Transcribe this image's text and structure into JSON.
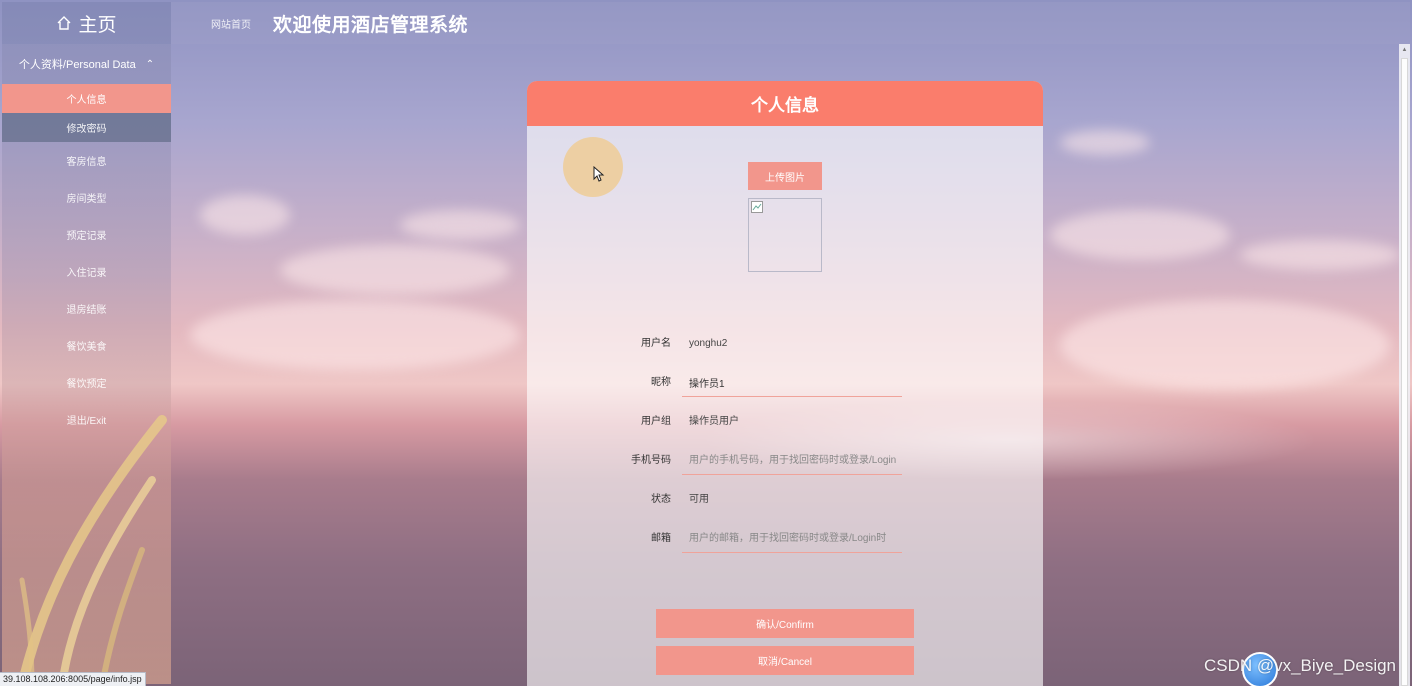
{
  "sidebar": {
    "home_label": "主页",
    "section_label": "个人资料/Personal Data",
    "items": [
      {
        "label": "个人信息"
      },
      {
        "label": "修改密码"
      },
      {
        "label": "客房信息"
      },
      {
        "label": "房间类型"
      },
      {
        "label": "预定记录"
      },
      {
        "label": "入住记录"
      },
      {
        "label": "退房结账"
      },
      {
        "label": "餐饮美食"
      },
      {
        "label": "餐饮预定"
      },
      {
        "label": "退出/Exit"
      }
    ]
  },
  "header": {
    "breadcrumb": "网站首页",
    "title": "欢迎使用酒店管理系统"
  },
  "panel": {
    "title": "个人信息",
    "upload_label": "上传图片",
    "fields": {
      "username": {
        "label": "用户名",
        "value": "yonghu2"
      },
      "nickname": {
        "label": "昵称",
        "value": "操作员1"
      },
      "group": {
        "label": "用户组",
        "value": "操作员用户"
      },
      "phone": {
        "label": "手机号码",
        "placeholder": "用户的手机号码，用于找回密码时或登录/Login"
      },
      "status": {
        "label": "状态",
        "value": "可用"
      },
      "email": {
        "label": "邮箱",
        "placeholder": "用户的邮箱，用于找回密码时或登录/Login时"
      }
    },
    "confirm_label": "确认/Confirm",
    "cancel_label": "取消/Cancel"
  },
  "status_bar": {
    "url": "39.108.108.206:8005/page/info.jsp"
  },
  "watermark": "CSDN @vx_Biye_Design",
  "colors": {
    "accent": "#fa7d6c",
    "button": "#f2968c"
  }
}
